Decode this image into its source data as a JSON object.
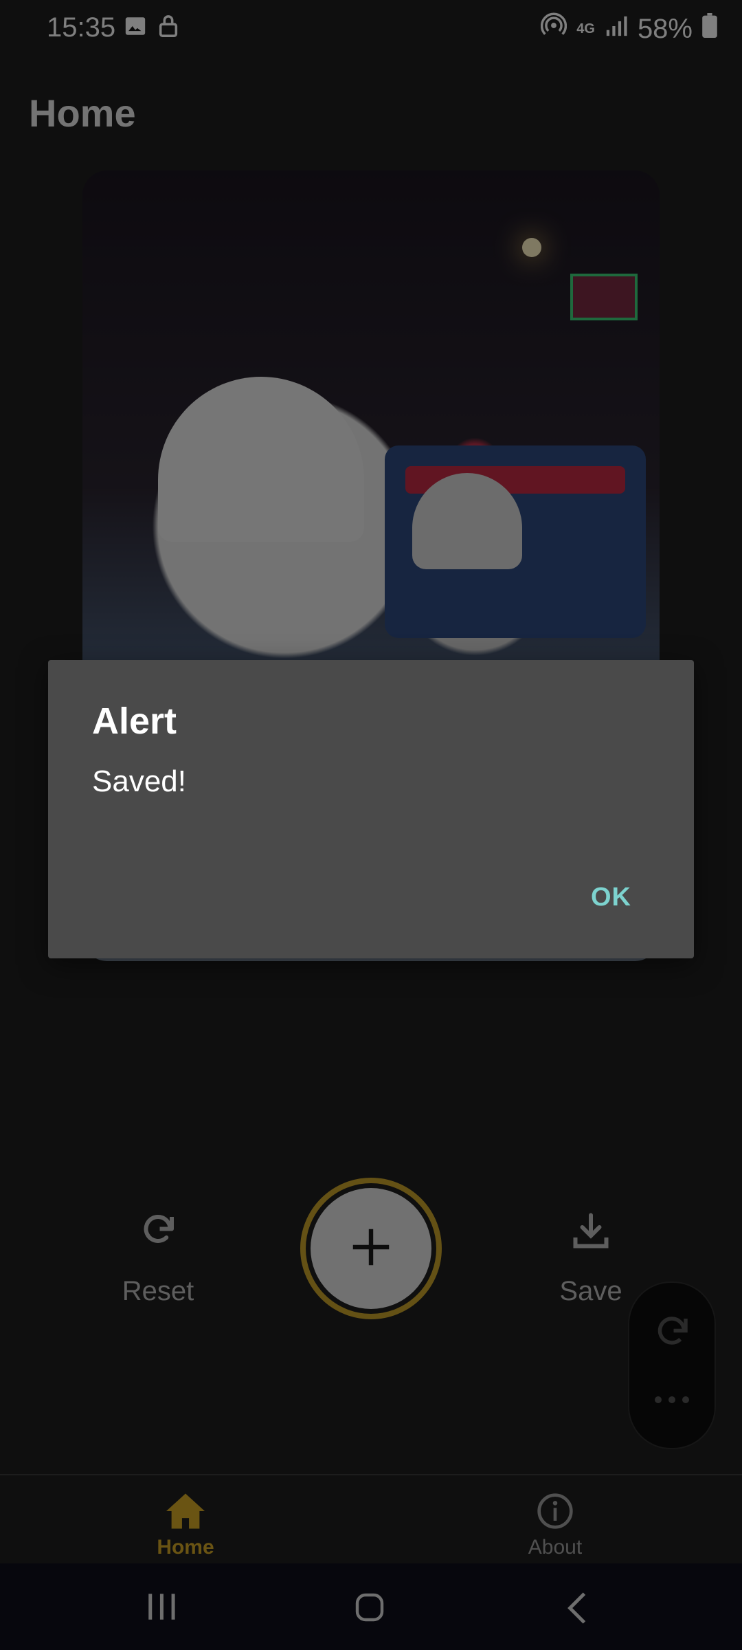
{
  "status_bar": {
    "time": "15:35",
    "battery": "58%",
    "network": "4G"
  },
  "header": {
    "title": "Home"
  },
  "actions": {
    "reset_label": "Reset",
    "save_label": "Save"
  },
  "bottom_nav": {
    "items": [
      {
        "label": "Home",
        "icon": "home-icon",
        "active": true
      },
      {
        "label": "About",
        "icon": "info-icon",
        "active": false
      }
    ]
  },
  "dialog": {
    "title": "Alert",
    "message": "Saved!",
    "ok_label": "OK"
  },
  "colors": {
    "accent": "#d5a827",
    "dialog_button": "#7dd3cf",
    "dialog_bg": "#4a4a4a"
  }
}
